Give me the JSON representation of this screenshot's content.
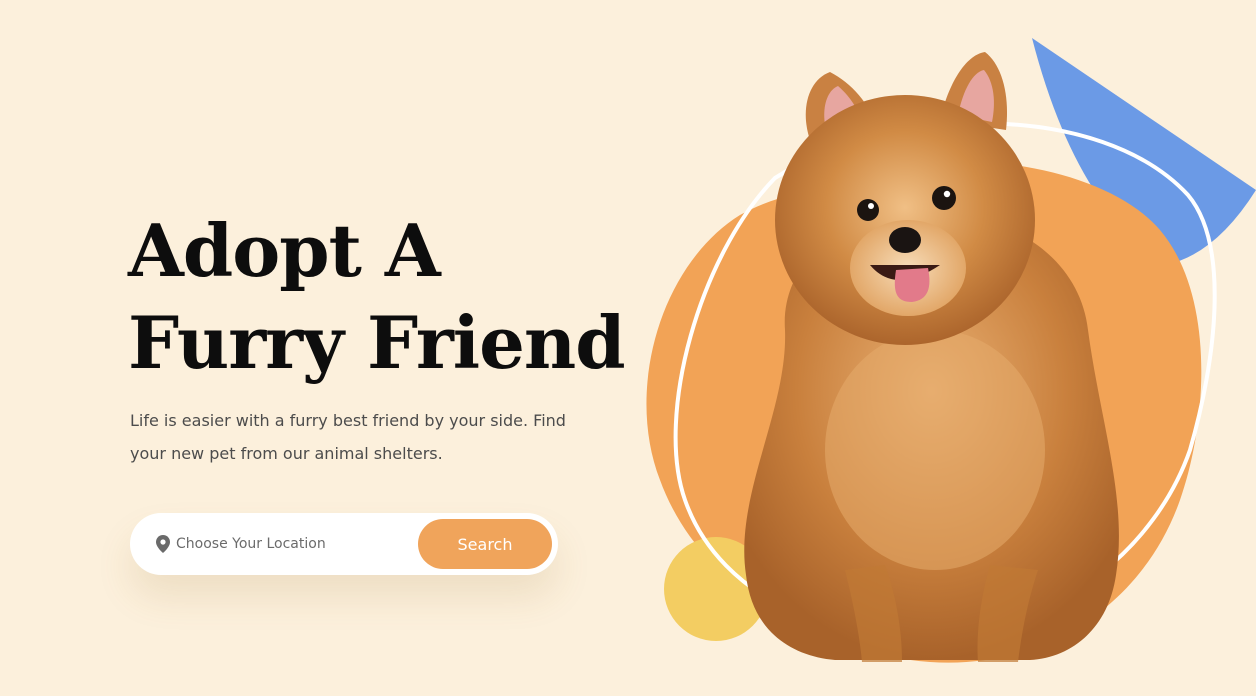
{
  "hero": {
    "title_line1": "Adopt A",
    "title_line2": "Furry Friend",
    "description": "Life is easier with a furry best friend by your side. Find your new pet from our animal shelters."
  },
  "search": {
    "placeholder": "Choose Your Location",
    "button_label": "Search",
    "location_icon": "map-pin-icon"
  },
  "colors": {
    "background": "#fcf0dc",
    "accent_orange": "#f0a45b",
    "blob_orange": "#f2a356",
    "accent_blue": "#6b9ae6",
    "accent_yellow": "#f3cd62"
  }
}
